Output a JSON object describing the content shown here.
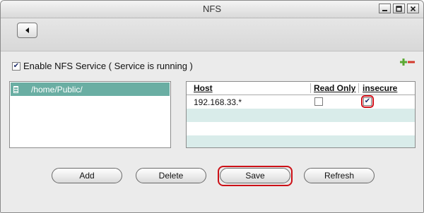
{
  "window": {
    "title": "NFS",
    "controls": [
      "minimize-icon",
      "maximize-icon",
      "close-icon"
    ]
  },
  "toolbar": {
    "back_icon": "back-arrow-icon"
  },
  "nfs": {
    "enable_checked": true,
    "enable_label": "Enable NFS Service ( Service is running )",
    "add_icon": "plus-icon",
    "remove_icon": "minus-icon"
  },
  "folders": [
    {
      "path": "/home/Public/",
      "selected": true,
      "icon": "folder-icon"
    }
  ],
  "hosts": {
    "columns": {
      "host": "Host",
      "read_only": "Read Only",
      "insecure": "insecure"
    },
    "rows": [
      {
        "host": "192.168.33.*",
        "read_only": false,
        "insecure": true
      }
    ]
  },
  "buttons": {
    "add": "Add",
    "delete": "Delete",
    "save": "Save",
    "refresh": "Refresh"
  },
  "colors": {
    "selection": "#6aaea3",
    "alt_row": "#d9ecea",
    "highlight": "#cc1016",
    "accent_green": "#5aa832",
    "accent_red": "#d33a2c"
  }
}
